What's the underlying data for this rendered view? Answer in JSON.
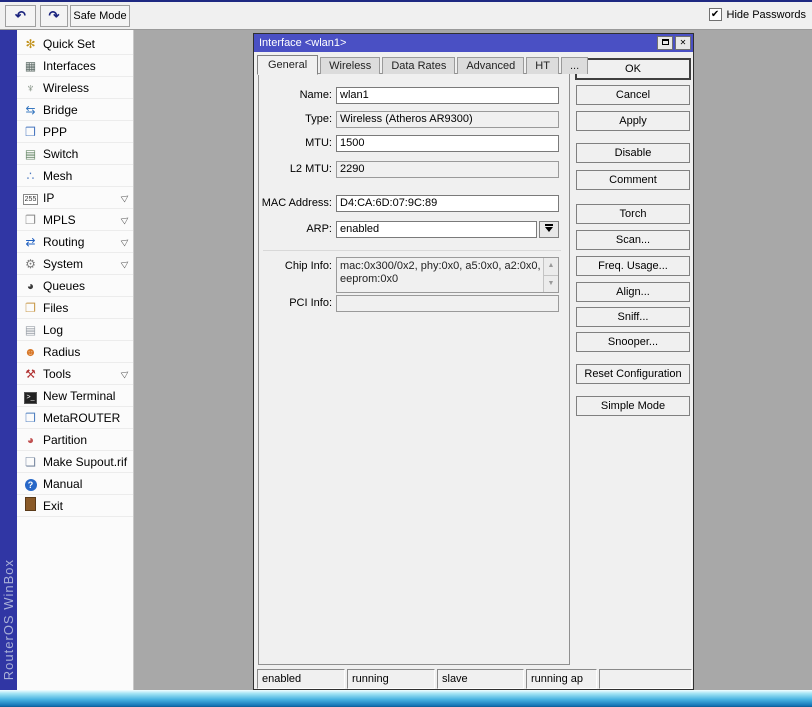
{
  "toolbar": {
    "safe_mode_label": "Safe Mode",
    "hide_passwords_label": "Hide Passwords"
  },
  "brand": "RouterOS WinBox",
  "colors": {
    "titlebar": "#4a50c4",
    "brand_strip": "#3036a4",
    "workspace": "#a8a8a8",
    "bottom_border": "#2a9fd8"
  },
  "sidebar": {
    "items": [
      {
        "label": "Quick Set",
        "icon": "magic-wand-icon",
        "has_submenu": false
      },
      {
        "label": "Interfaces",
        "icon": "network-card-icon",
        "has_submenu": false
      },
      {
        "label": "Wireless",
        "icon": "antenna-icon",
        "has_submenu": false
      },
      {
        "label": "Bridge",
        "icon": "bridge-arrows-icon",
        "has_submenu": false
      },
      {
        "label": "PPP",
        "icon": "computers-icon",
        "has_submenu": false
      },
      {
        "label": "Switch",
        "icon": "switch-device-icon",
        "has_submenu": false
      },
      {
        "label": "Mesh",
        "icon": "mesh-nodes-icon",
        "has_submenu": false
      },
      {
        "label": "IP",
        "icon": "ip-255-icon",
        "has_submenu": true
      },
      {
        "label": "MPLS",
        "icon": "tags-icon",
        "has_submenu": true
      },
      {
        "label": "Routing",
        "icon": "routing-arrows-icon",
        "has_submenu": true
      },
      {
        "label": "System",
        "icon": "gear-icon",
        "has_submenu": true
      },
      {
        "label": "Queues",
        "icon": "gauge-icon",
        "has_submenu": false
      },
      {
        "label": "Files",
        "icon": "folder-icon",
        "has_submenu": false
      },
      {
        "label": "Log",
        "icon": "log-paper-icon",
        "has_submenu": false
      },
      {
        "label": "Radius",
        "icon": "people-icon",
        "has_submenu": false
      },
      {
        "label": "Tools",
        "icon": "tools-icon",
        "has_submenu": true
      },
      {
        "label": "New Terminal",
        "icon": "terminal-icon",
        "has_submenu": false
      },
      {
        "label": "MetaROUTER",
        "icon": "computer-icon",
        "has_submenu": false
      },
      {
        "label": "Partition",
        "icon": "pie-chart-icon",
        "has_submenu": false
      },
      {
        "label": "Make Supout.rif",
        "icon": "document-icon",
        "has_submenu": false
      },
      {
        "label": "Manual",
        "icon": "question-mark-icon",
        "has_submenu": false
      },
      {
        "label": "Exit",
        "icon": "door-icon",
        "has_submenu": false
      }
    ]
  },
  "dialog": {
    "title": "Interface <wlan1>",
    "tabs": [
      "General",
      "Wireless",
      "Data Rates",
      "Advanced",
      "HT",
      "..."
    ],
    "form": {
      "name_label": "Name:",
      "name_value": "wlan1",
      "type_label": "Type:",
      "type_value": "Wireless (Atheros AR9300)",
      "mtu_label": "MTU:",
      "mtu_value": "1500",
      "l2mtu_label": "L2 MTU:",
      "l2mtu_value": "2290",
      "mac_label": "MAC Address:",
      "mac_value": "D4:CA:6D:07:9C:89",
      "arp_label": "ARP:",
      "arp_value": "enabled",
      "chip_label": "Chip Info:",
      "chip_value": "mac:0x300/0x2, phy:0x0, a5:0x0, a2:0x0, eeprom:0x0",
      "pci_label": "PCI Info:",
      "pci_value": ""
    },
    "buttons": [
      "OK",
      "Cancel",
      "Apply",
      "Disable",
      "Comment",
      "Torch",
      "Scan...",
      "Freq. Usage...",
      "Align...",
      "Sniff...",
      "Snooper...",
      "Reset Configuration",
      "Simple Mode"
    ],
    "status_cells": [
      "enabled",
      "running",
      "slave",
      "running ap",
      ""
    ]
  }
}
